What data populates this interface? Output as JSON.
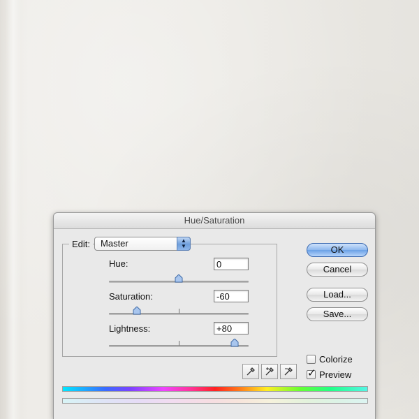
{
  "dialog": {
    "title": "Hue/Saturation",
    "edit_label": "Edit:",
    "edit_value": "Master",
    "hue": {
      "label": "Hue:",
      "value": "0",
      "range": [
        -180,
        180
      ],
      "slider_value": 0
    },
    "saturation": {
      "label": "Saturation:",
      "value": "-60",
      "range": [
        -100,
        100
      ],
      "slider_value": -60
    },
    "lightness": {
      "label": "Lightness:",
      "value": "+80",
      "range": [
        -100,
        100
      ],
      "slider_value": 80
    },
    "buttons": {
      "ok": "OK",
      "cancel": "Cancel",
      "load": "Load...",
      "save": "Save..."
    },
    "colorize": {
      "label": "Colorize",
      "checked": false
    },
    "preview": {
      "label": "Preview",
      "checked": true
    },
    "icons": [
      "eyedropper-icon",
      "eyedropper-plus-icon",
      "eyedropper-minus-icon"
    ],
    "colors": {
      "ok_button": "#8db8ee",
      "select_arrow": "#6f9fdc"
    }
  }
}
